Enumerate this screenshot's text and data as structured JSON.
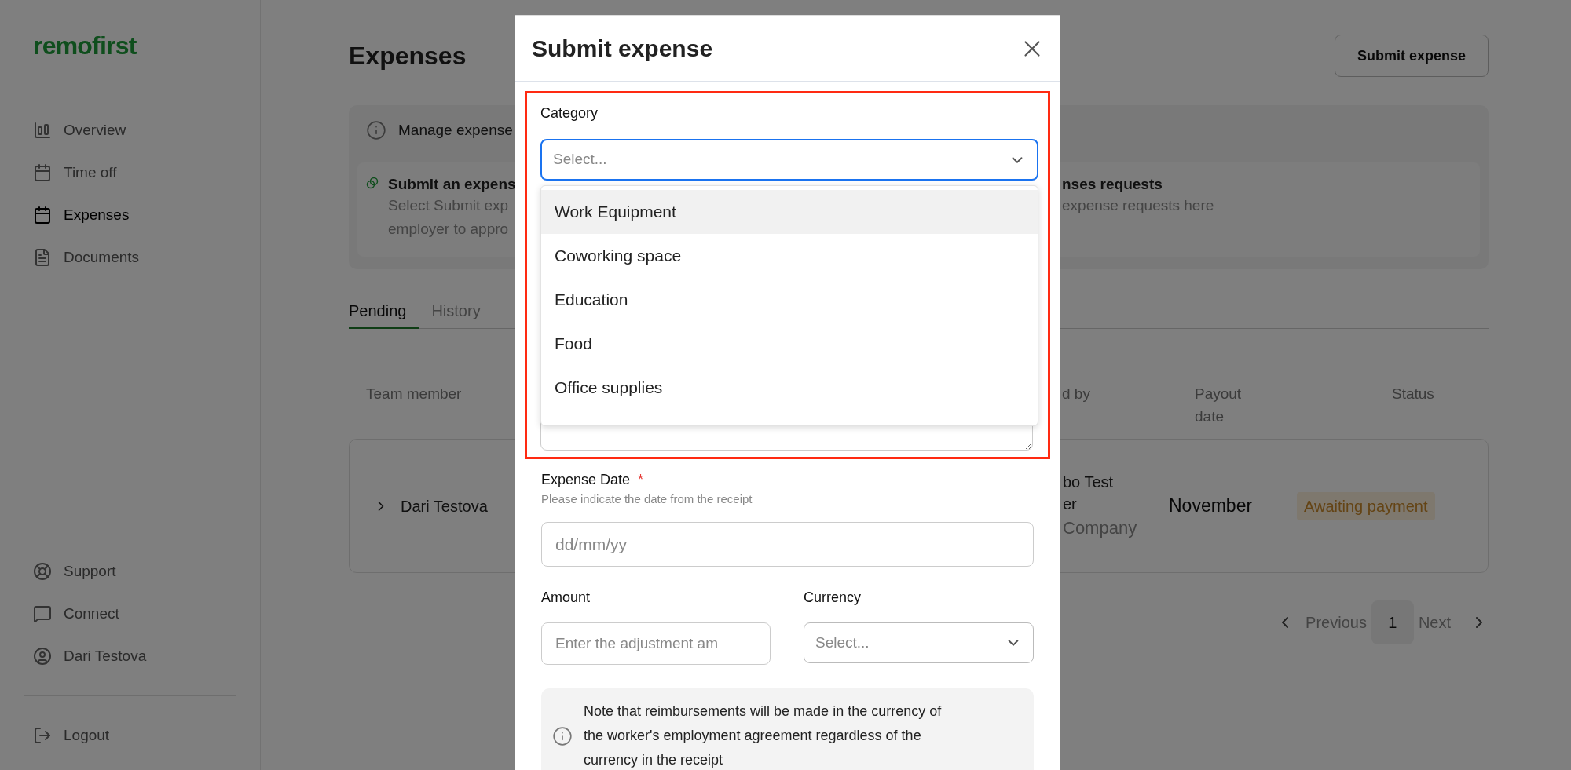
{
  "sidebar": {
    "logo": "remofirst",
    "nav": [
      {
        "label": "Overview",
        "selected": false
      },
      {
        "label": "Time off",
        "selected": false
      },
      {
        "label": "Expenses",
        "selected": true
      },
      {
        "label": "Documents",
        "selected": false
      }
    ],
    "bottom": [
      {
        "label": "Support"
      },
      {
        "label": "Connect"
      },
      {
        "label": "Dari Testova"
      }
    ],
    "logout": "Logout"
  },
  "page": {
    "title": "Expenses",
    "submit_button": "Submit expense",
    "info": {
      "title": "Manage expense",
      "cards": [
        {
          "title": "Submit an expens",
          "lines": [
            "Select Submit exp",
            "employer to appro"
          ]
        },
        {
          "title": "nses requests",
          "lines": [
            "expense requests here"
          ]
        }
      ]
    },
    "tabs": [
      {
        "label": "Pending",
        "selected": true
      },
      {
        "label": "History",
        "selected": false
      }
    ],
    "table": {
      "columns": [
        "Team member",
        "d by",
        "Payout date",
        "Status"
      ],
      "rows": [
        {
          "member": "Dari Testova",
          "column_2": [
            "bo Test",
            "er",
            "Company"
          ],
          "payout": "November",
          "status": "Awaiting payment"
        }
      ]
    },
    "pagination": {
      "previous": "Previous",
      "pages": [
        {
          "label": "1",
          "selected": true
        }
      ],
      "next": "Next"
    }
  },
  "modal": {
    "title": "Submit expense",
    "category": {
      "label": "Category",
      "placeholder": "Select...",
      "focused": true,
      "options": [
        {
          "label": "Work Equipment",
          "highlighted": true
        },
        {
          "label": "Coworking space",
          "highlighted": false
        },
        {
          "label": "Education",
          "highlighted": false
        },
        {
          "label": "Food",
          "highlighted": false
        },
        {
          "label": "Office supplies",
          "highlighted": false
        }
      ]
    },
    "expense_date": {
      "label": "Expense Date",
      "required_mark": "*",
      "hint": "Please indicate the date from the receipt",
      "placeholder": "dd/mm/yy"
    },
    "amount": {
      "label": "Amount",
      "placeholder": "Enter the adjustment am"
    },
    "currency": {
      "label": "Currency",
      "placeholder": "Select..."
    },
    "note": "Note that reimbursements will be made in the currency of the worker's employment agreement regardless of the currency in the receipt"
  }
}
